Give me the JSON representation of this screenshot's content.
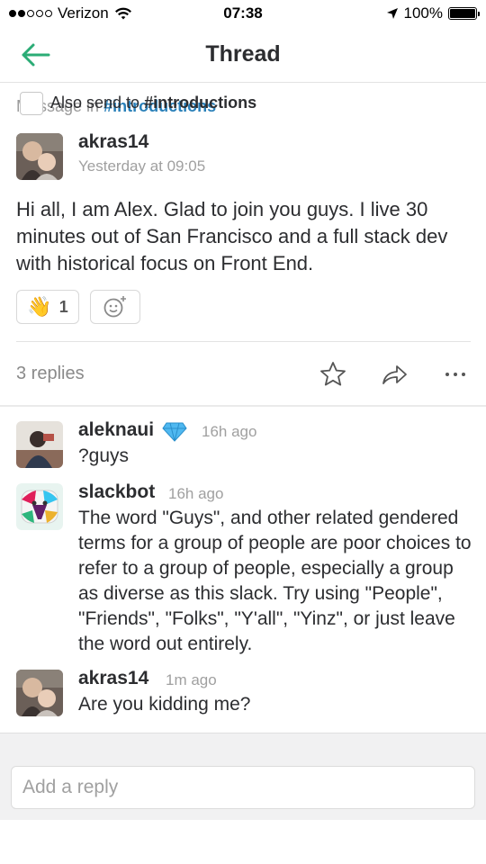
{
  "status_bar": {
    "carrier": "Verizon",
    "time": "07:38",
    "battery": "100%",
    "battery_level": 1.0,
    "signal_bars_filled": 2,
    "signal_bars_total": 5
  },
  "nav": {
    "title": "Thread",
    "back_icon": "arrow-left-icon",
    "accent_color": "#2bac76"
  },
  "parent_message": {
    "context_prefix": "Message in",
    "channel": "#introductions",
    "author": "akras14",
    "timestamp": "Yesterday at 09:05",
    "text": "Hi all, I am Alex. Glad to join you guys. I live 30 minutes out of San Francisco and a full stack dev with historical focus on Front End.",
    "reactions": [
      {
        "emoji": "👋",
        "icon": "waving-hand-icon",
        "count": "1"
      }
    ],
    "add_reaction_icon": "add-reaction-icon"
  },
  "thread_actions": {
    "replies_label": "3 replies",
    "icons": [
      "star-icon",
      "share-icon",
      "more-icon"
    ]
  },
  "replies": [
    {
      "author": "aleknaui",
      "badge_icon": "diamond-icon",
      "time": "16h ago",
      "text": "?guys"
    },
    {
      "author": "slackbot",
      "time": "16h ago",
      "text": "The word \"Guys\", and other related gendered terms for a group of people are poor choices to refer to a group of people, especially a group as diverse as this slack. Try using \"People\", \"Friends\", \"Folks\", \"Y'all\", \"Yinz\", or just leave the word out entirely."
    },
    {
      "author": "akras14",
      "time": "1m ago",
      "text": "Are you kidding me?"
    }
  ],
  "composer": {
    "placeholder": "Add a reply",
    "also_send_prefix": "Also send to",
    "also_send_channel": "#introductions",
    "checked": false
  },
  "colors": {
    "link": "#2a80b9",
    "accent": "#2bac76",
    "muted": "#9a9a9a",
    "diamond": "#4fb8f0"
  }
}
